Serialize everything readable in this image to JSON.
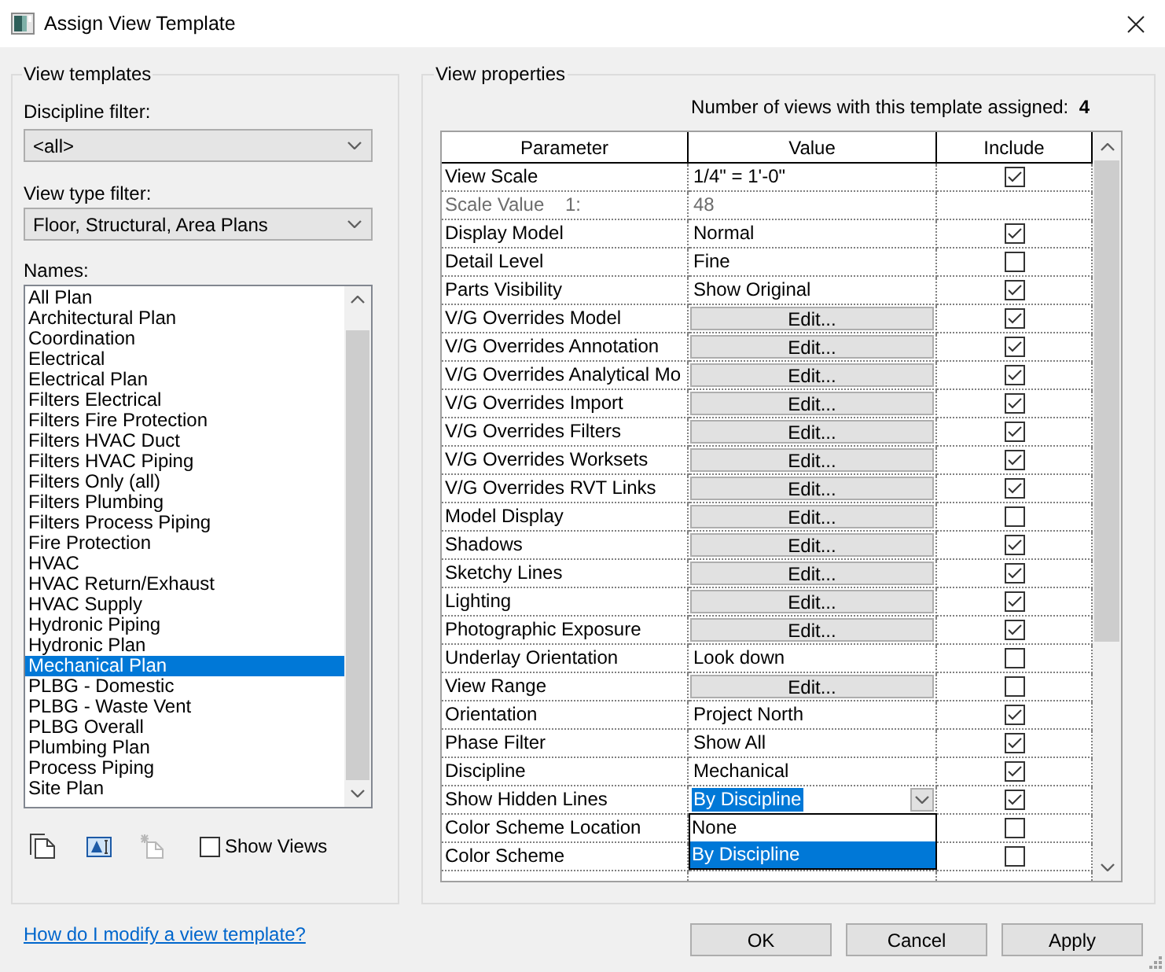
{
  "window": {
    "title": "Assign View Template"
  },
  "view_templates": {
    "legend": "View templates",
    "discipline_filter": {
      "label": "Discipline filter:",
      "value": "<all>"
    },
    "view_type_filter": {
      "label": "View type filter:",
      "value": "Floor, Structural, Area Plans"
    },
    "names": {
      "label": "Names:",
      "items": [
        {
          "label": "All Plan",
          "selected": false
        },
        {
          "label": "Architectural Plan",
          "selected": false
        },
        {
          "label": "Coordination",
          "selected": false
        },
        {
          "label": "Electrical",
          "selected": false
        },
        {
          "label": "Electrical Plan",
          "selected": false
        },
        {
          "label": "Filters Electrical",
          "selected": false
        },
        {
          "label": "Filters Fire Protection",
          "selected": false
        },
        {
          "label": "Filters HVAC Duct",
          "selected": false
        },
        {
          "label": "Filters HVAC Piping",
          "selected": false
        },
        {
          "label": "Filters Only (all)",
          "selected": false
        },
        {
          "label": "Filters Plumbing",
          "selected": false
        },
        {
          "label": "Filters Process Piping",
          "selected": false
        },
        {
          "label": "Fire Protection",
          "selected": false
        },
        {
          "label": "HVAC",
          "selected": false
        },
        {
          "label": "HVAC Return/Exhaust",
          "selected": false
        },
        {
          "label": "HVAC Supply",
          "selected": false
        },
        {
          "label": "Hydronic Piping",
          "selected": false
        },
        {
          "label": "Hydronic Plan",
          "selected": false
        },
        {
          "label": "Mechanical Plan",
          "selected": true
        },
        {
          "label": "PLBG - Domestic",
          "selected": false
        },
        {
          "label": "PLBG - Waste Vent",
          "selected": false
        },
        {
          "label": "PLBG Overall",
          "selected": false
        },
        {
          "label": "Plumbing Plan",
          "selected": false
        },
        {
          "label": "Process Piping",
          "selected": false
        },
        {
          "label": "Site Plan",
          "selected": false
        }
      ]
    },
    "tools": [
      {
        "kind": "duplicate",
        "disabled": false
      },
      {
        "kind": "rename",
        "disabled": false
      },
      {
        "kind": "new",
        "disabled": true
      }
    ],
    "show_views": {
      "label": "Show Views",
      "checked": false
    }
  },
  "view_properties": {
    "legend": "View properties",
    "assigned": "Number of views with this template assigned:  **4**",
    "columns": [
      "Parameter",
      "Value",
      "Include"
    ],
    "rows": [
      {
        "parameter": "View Scale",
        "kind": "text",
        "value": "1/4\" = 1'-0\"",
        "include": true,
        "disabled": false
      },
      {
        "parameter": "Scale Value    1:",
        "kind": "text",
        "value": "48",
        "disabled": true
      },
      {
        "parameter": "Display Model",
        "kind": "text",
        "value": "Normal",
        "include": true,
        "disabled": false
      },
      {
        "parameter": "Detail Level",
        "kind": "text",
        "value": "Fine",
        "include": false,
        "disabled": false
      },
      {
        "parameter": "Parts Visibility",
        "kind": "text",
        "value": "Show Original",
        "include": true,
        "disabled": false
      },
      {
        "parameter": "V/G Overrides Model",
        "kind": "button",
        "value": "Edit...",
        "include": true,
        "disabled": false
      },
      {
        "parameter": "V/G Overrides Annotation",
        "kind": "button",
        "value": "Edit...",
        "include": true,
        "disabled": false
      },
      {
        "parameter": "V/G Overrides Analytical Mo",
        "kind": "button",
        "value": "Edit...",
        "include": true,
        "disabled": false
      },
      {
        "parameter": "V/G Overrides Import",
        "kind": "button",
        "value": "Edit...",
        "include": true,
        "disabled": false
      },
      {
        "parameter": "V/G Overrides Filters",
        "kind": "button",
        "value": "Edit...",
        "include": true,
        "disabled": false
      },
      {
        "parameter": "V/G Overrides Worksets",
        "kind": "button",
        "value": "Edit...",
        "include": true,
        "disabled": false
      },
      {
        "parameter": "V/G Overrides RVT Links",
        "kind": "button",
        "value": "Edit...",
        "include": true,
        "disabled": false
      },
      {
        "parameter": "Model Display",
        "kind": "button",
        "value": "Edit...",
        "include": false,
        "disabled": false
      },
      {
        "parameter": "Shadows",
        "kind": "button",
        "value": "Edit...",
        "include": true,
        "disabled": false
      },
      {
        "parameter": "Sketchy Lines",
        "kind": "button",
        "value": "Edit...",
        "include": true,
        "disabled": false
      },
      {
        "parameter": "Lighting",
        "kind": "button",
        "value": "Edit...",
        "include": true,
        "disabled": false
      },
      {
        "parameter": "Photographic Exposure",
        "kind": "button",
        "value": "Edit...",
        "include": true,
        "disabled": false
      },
      {
        "parameter": "Underlay Orientation",
        "kind": "text",
        "value": "Look down",
        "include": false,
        "disabled": false
      },
      {
        "parameter": "View Range",
        "kind": "button",
        "value": "Edit...",
        "include": false,
        "disabled": false
      },
      {
        "parameter": "Orientation",
        "kind": "text",
        "value": "Project North",
        "include": true,
        "disabled": false
      },
      {
        "parameter": "Phase Filter",
        "kind": "text",
        "value": "Show All",
        "include": true,
        "disabled": false
      },
      {
        "parameter": "Discipline",
        "kind": "text",
        "value": "Mechanical",
        "include": true,
        "disabled": false
      },
      {
        "parameter": "Show Hidden Lines",
        "kind": "dropdown",
        "value": "By Discipline",
        "expanded": true,
        "options": [
          {
            "label": "None",
            "selected": false
          },
          {
            "label": "By Discipline",
            "selected": true
          }
        ],
        "include": true,
        "disabled": false
      },
      {
        "parameter": "Color Scheme Location",
        "kind": "text",
        "include": false,
        "disabled": false
      },
      {
        "parameter": "Color Scheme",
        "kind": "text",
        "include": false,
        "disabled": false
      }
    ]
  },
  "help_link": "How do I modify a view template?",
  "buttons": [
    "OK",
    "Cancel",
    "Apply"
  ]
}
